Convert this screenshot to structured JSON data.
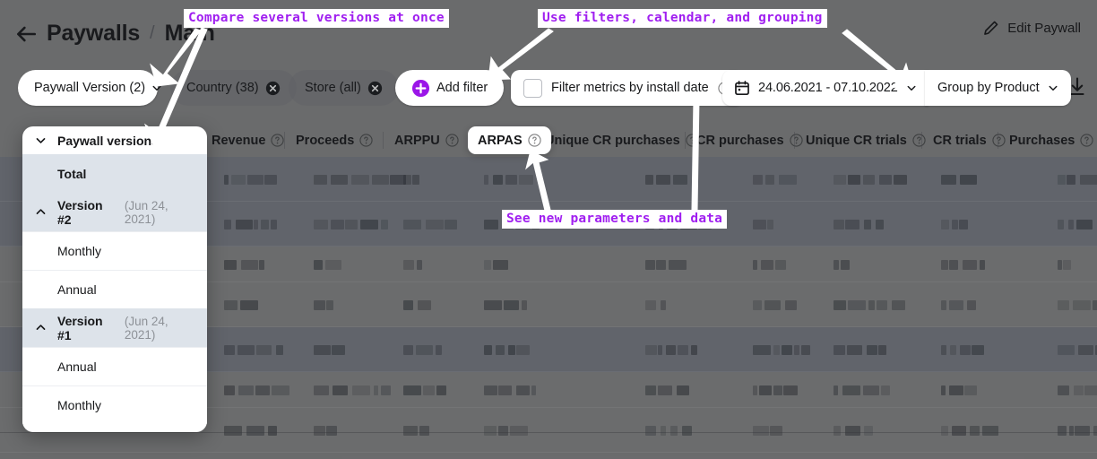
{
  "header": {
    "back_icon": "arrow-left-icon",
    "breadcrumb_root": "Paywalls",
    "breadcrumb_separator": "/",
    "breadcrumb_current": "Main",
    "edit_icon": "pencil-icon",
    "edit_label": "Edit Paywall"
  },
  "filters": {
    "paywall_version": {
      "label": "Paywall Version (2)",
      "icon": "chevron-down-icon"
    },
    "country": {
      "label": "Country (38)",
      "icon": "close-circle-icon"
    },
    "store": {
      "label": "Store (all)",
      "icon": "close-circle-icon"
    },
    "add_filter": {
      "label": "Add filter",
      "icon": "plus-circle-icon"
    },
    "install_date": {
      "label": "Filter metrics by install date",
      "help_icon": "question-circle-icon",
      "checked": false
    },
    "date_range": {
      "label": "24.06.2021 - 07.10.2022",
      "icon": "calendar-icon",
      "caret": "chevron-down-icon"
    },
    "group_by": {
      "label": "Group by Product",
      "caret": "chevron-down-icon"
    },
    "download": {
      "icon": "download-icon"
    }
  },
  "versions_panel": {
    "title": "Paywall versions",
    "title_icon": "chevron-down-icon",
    "items": [
      {
        "label": "Total",
        "date": "",
        "selected": true,
        "bold": true,
        "icon": ""
      },
      {
        "label": "Version #2",
        "date": "(Jun 24, 2021)",
        "selected": true,
        "bold": true,
        "icon": "chevron-up-icon"
      },
      {
        "label": "Monthly",
        "date": "",
        "selected": false,
        "bold": false,
        "icon": ""
      },
      {
        "label": "Annual",
        "date": "",
        "selected": false,
        "bold": false,
        "icon": ""
      },
      {
        "label": "Version #1",
        "date": "(Jun 24, 2021)",
        "selected": true,
        "bold": true,
        "icon": "chevron-up-icon"
      },
      {
        "label": "Annual",
        "date": "",
        "selected": false,
        "bold": false,
        "icon": ""
      },
      {
        "label": "Monthly",
        "date": "",
        "selected": false,
        "bold": false,
        "icon": ""
      }
    ]
  },
  "table": {
    "columns": [
      {
        "label": "Revenue",
        "help": "question-circle-icon",
        "raised": false
      },
      {
        "label": "Proceeds",
        "help": "question-circle-icon",
        "raised": false
      },
      {
        "label": "ARPPU",
        "help": "question-circle-icon",
        "raised": false
      },
      {
        "label": "ARPAS",
        "help": "question-circle-icon",
        "raised": true
      },
      {
        "label": "Unique CR purchases",
        "help": "question-circle-icon",
        "raised": false
      },
      {
        "label": "CR purchases",
        "help": "question-circle-icon",
        "raised": false
      },
      {
        "label": "Unique CR trials",
        "help": "question-circle-icon",
        "raised": false
      },
      {
        "label": "CR trials",
        "help": "question-circle-icon",
        "raised": false
      },
      {
        "label": "Purchases",
        "help": "question-circle-icon",
        "raised": false
      }
    ],
    "rows": [
      {
        "tone": "dark",
        "obscured": true
      },
      {
        "tone": "dark",
        "obscured": true
      },
      {
        "tone": "light",
        "obscured": true
      },
      {
        "tone": "light",
        "obscured": true
      },
      {
        "tone": "dark",
        "obscured": true
      },
      {
        "tone": "light",
        "obscured": true
      },
      {
        "tone": "light",
        "obscured": true
      }
    ],
    "values_hidden_note": "cell values are visually blurred / unreadable"
  },
  "annotations": [
    {
      "name": "compare-versions-callout",
      "text": "Compare several versions at once"
    },
    {
      "name": "filters-calendar-grouping-callout",
      "text": "Use filters, calendar, and grouping"
    },
    {
      "name": "new-parameters-callout",
      "text": "See new parameters and data"
    }
  ],
  "colors": {
    "accent_purple": "#a01ff0",
    "selected_row": "#dde3ea",
    "surface": "#ffffff",
    "text": "#17181a",
    "muted_text": "#8d9197"
  }
}
